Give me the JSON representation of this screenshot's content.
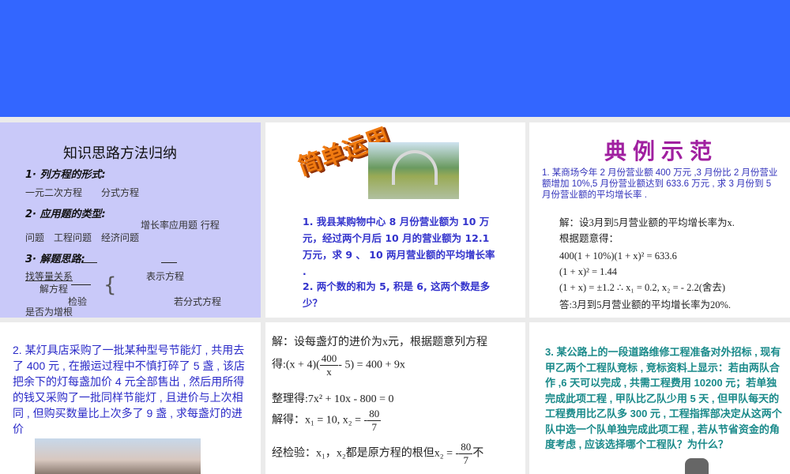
{
  "slide1": {
    "title": "知识思路方法归纳",
    "h1": "1· 列方程的形式:",
    "l1": "一元二次方程　　分式方程",
    "h2": "2· 应用题的类型:",
    "l2a": "增长率应用题  行程",
    "l2b": "问题　工程问题　经济问题",
    "h3": "3· 解题思路:",
    "s1": "找等量关系",
    "s2": "表示方程",
    "s3": "解方程",
    "s4": "检验",
    "s5": "若分式方程",
    "s6": "是否为增根"
  },
  "slide2": {
    "wordart": "简单运用",
    "q1": "1. 我县某购物中心 8 月份营业额为 10 万元，经过两个月后 10 月的营业额为 12.1 万元，求 9 、 10 两月营业额的平均增长率 .",
    "q2": "2. 两个数的和为 5, 积是 6, 这两个数是多少？"
  },
  "slide3": {
    "wordart": "典例示范",
    "problem": "1. 某商场今年 2 月份营业额 400 万元 ,3 月份比 2 月份营业额增加 10%,5 月份营业额达到 633.6 万元 , 求 3 月份到 5 月份营业额的平均增长率 .",
    "lines": [
      "解：设3月到5月营业额的平均增长率为x.",
      "根据题意得：",
      "400(1 + 10%)(1 + x)² = 633.6",
      "(1 + x)² = 1.44",
      "(1 + x) = ±1.2 ∴ x₁ = 0.2, x₂ = - 2.2(舍去)",
      "答:3月到5月营业额的平均增长率为20%."
    ]
  },
  "slide4": {
    "problem": "2. 某灯具店采购了一批某种型号节能灯 , 共用去了 400 元 , 在搬运过程中不慎打碎了 5 盏 , 该店把余下的灯每盏加价 4 元全部售出 , 然后用所得的钱又采购了一批同样节能灯 , 且进价与上次相同 , 但购买数量比上次多了 9 盏 , 求每盏灯的进价"
  },
  "slide5": {
    "l1": "解：设每盏灯的进价为x元，根据题意列方程",
    "l2a": "得:(x + 4)(",
    "l2num": "400",
    "l2den": "x",
    "l2b": "- 5) = 400 + 9x",
    "l3": "整理得:7x² + 10x - 800 = 0",
    "l4a": "解得：x₁ = 10, x₂ = -",
    "l4num": "80",
    "l4den": "7",
    "l5a": "经检验：x₁，x₂都是原方程的根但x₂ = -",
    "l5num": "80",
    "l5den": "7",
    "l5b": "不"
  },
  "slide6": {
    "problem": "3. 某公路上的一段道路维修工程准备对外招标 , 现有甲乙两个工程队竞标 , 竞标资料上显示：若由两队合作 ,6 天可以完成 , 共需工程费用 10200 元；若单独完成此项工程 , 甲队比乙队少用 5 天 , 但甲队每天的工程费用比乙队多 300 元 , 工程指挥部决定从这两个队中选一个队单独完成此项工程 , 若从节省资金的角度考虑 , 应该选择哪个工程队？为什么？"
  }
}
